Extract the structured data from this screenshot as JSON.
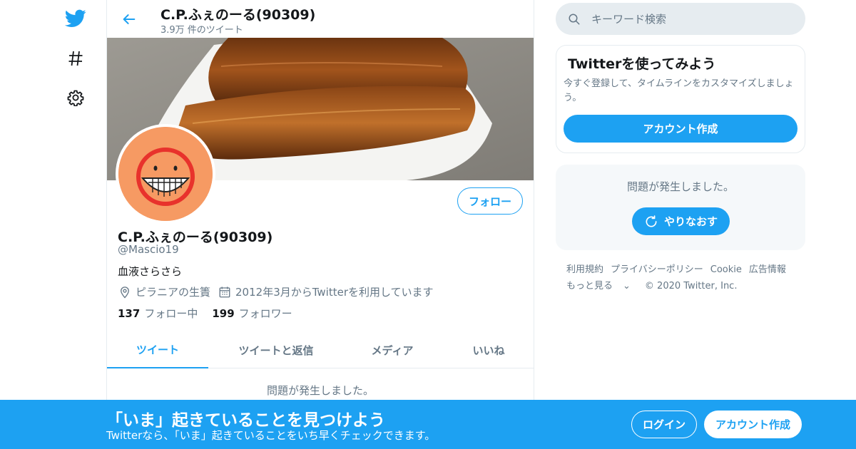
{
  "brand": {
    "accent": "#1da1f2",
    "text_secondary": "#657786",
    "border": "#e6ecf0"
  },
  "nav": {
    "icons": [
      "twitter-bird-icon",
      "hashtag-icon",
      "gear-icon"
    ]
  },
  "header": {
    "title": "C.P.ふぇのーる(90309)",
    "tweet_count": "3.9万 件のツイート"
  },
  "profile": {
    "name": "C.P.ふぇのーる(90309)",
    "handle": "@Mascio19",
    "bio": "血液さらさら",
    "location": "ピラニアの生簀",
    "joined": "2012年3月からTwitterを利用しています",
    "following_count": "137",
    "following_label": "フォロー中",
    "followers_count": "199",
    "followers_label": "フォロワー",
    "follow_button": "フォロー"
  },
  "tabs": [
    {
      "label": "ツイート",
      "active": true
    },
    {
      "label": "ツイートと返信",
      "active": false
    },
    {
      "label": "メディア",
      "active": false
    },
    {
      "label": "いいね",
      "active": false
    }
  ],
  "timeline": {
    "error": "問題が発生しました。"
  },
  "search": {
    "placeholder": "キーワード検索"
  },
  "signup_card": {
    "title": "Twitterを使ってみよう",
    "description": "今すぐ登録して、タイムラインをカスタマイズしましょう。",
    "button": "アカウント作成"
  },
  "error_card": {
    "message": "問題が発生しました。",
    "retry": "やりなおす"
  },
  "footer": {
    "links": [
      "利用規約",
      "プライバシーポリシー",
      "Cookie",
      "広告情報"
    ],
    "more": "もっと見る",
    "copyright": "© 2020 Twitter, Inc."
  },
  "bottom_bar": {
    "title": "「いま」起きていることを見つけよう",
    "subtitle": "Twitterなら、「いま」起きていることをいち早くチェックできます。",
    "login": "ログイン",
    "signup": "アカウント作成"
  }
}
